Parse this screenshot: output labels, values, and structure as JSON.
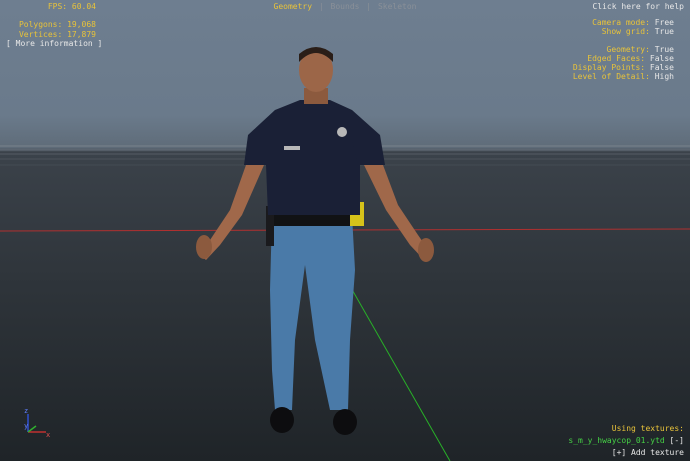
{
  "stats": {
    "fps": "FPS: 60.04",
    "polygons": "Polygons: 19,068",
    "vertices": "Vertices: 17,879"
  },
  "more_info": "[ More information ]",
  "tabs": [
    {
      "label": "Geometry",
      "active": true
    },
    {
      "label": "Bounds",
      "active": false
    },
    {
      "label": "Skeleton",
      "active": false
    }
  ],
  "tab_separator": "|",
  "help": "Click here for help",
  "settings": {
    "camera_mode": {
      "label": "Camera mode:",
      "value": "Free"
    },
    "show_grid": {
      "label": "Show grid:",
      "value": "True"
    },
    "geometry": {
      "label": "Geometry:",
      "value": "True"
    },
    "edged_faces": {
      "label": "Edged Faces:",
      "value": "False"
    },
    "display_points": {
      "label": "Display Points:",
      "value": "False"
    },
    "level_of_detail": {
      "label": "Level of Detail:",
      "value": "High"
    }
  },
  "textures": {
    "heading": "Using textures:",
    "file": "s_m_y_hwaycop_01.ytd",
    "collapse": "[-]",
    "add": "[+] Add texture"
  },
  "axis_gizmo": {
    "z": "z",
    "y": "y",
    "x": "x"
  },
  "colors": {
    "hud_yellow": "#e8c33a",
    "hud_white": "#e8e8e8",
    "hud_green": "#45d045",
    "hud_muted": "#8a9098",
    "uniform_shirt": "#1a2036",
    "uniform_pants": "#4a7aa8"
  }
}
